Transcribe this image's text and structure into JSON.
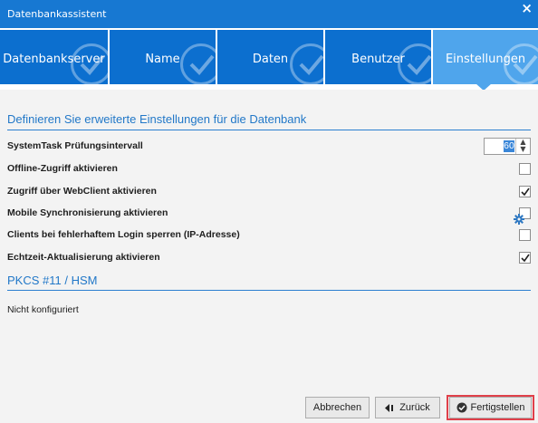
{
  "window": {
    "title": "Datenbankassistent",
    "close_glyph": "×"
  },
  "steps": [
    {
      "label": "Datenbankserver",
      "done": true,
      "active": false
    },
    {
      "label": "Name",
      "done": true,
      "active": false
    },
    {
      "label": "Daten",
      "done": true,
      "active": false
    },
    {
      "label": "Benutzer",
      "done": true,
      "active": false
    },
    {
      "label": "Einstellungen",
      "done": true,
      "active": true
    }
  ],
  "advanced": {
    "heading": "Definieren Sie erweiterte Einstellungen für die Datenbank",
    "interval": {
      "label": "SystemTask Prüfungsintervall",
      "value": "60"
    },
    "options": [
      {
        "label": "Offline-Zugriff aktivieren",
        "checked": false
      },
      {
        "label": "Zugriff über WebClient aktivieren",
        "checked": true
      },
      {
        "label": "Mobile Synchronisierung aktivieren",
        "checked": false
      },
      {
        "label": "Clients bei fehlerhaftem Login sperren (IP-Adresse)",
        "checked": false
      },
      {
        "label": "Echtzeit-Aktualisierung aktivieren",
        "checked": true
      }
    ]
  },
  "pkcs": {
    "heading": "PKCS #11 / HSM",
    "status": "Nicht konfiguriert",
    "settings_icon": "gear-icon"
  },
  "footer": {
    "cancel": "Abbrechen",
    "back": "Zurück",
    "finish": "Fertigstellen"
  },
  "colors": {
    "title_bar": "#1778d2",
    "step": "#0c6fcf",
    "step_active": "#4fa5ec",
    "heading": "#2278c8",
    "highlight": "#e0404a"
  }
}
